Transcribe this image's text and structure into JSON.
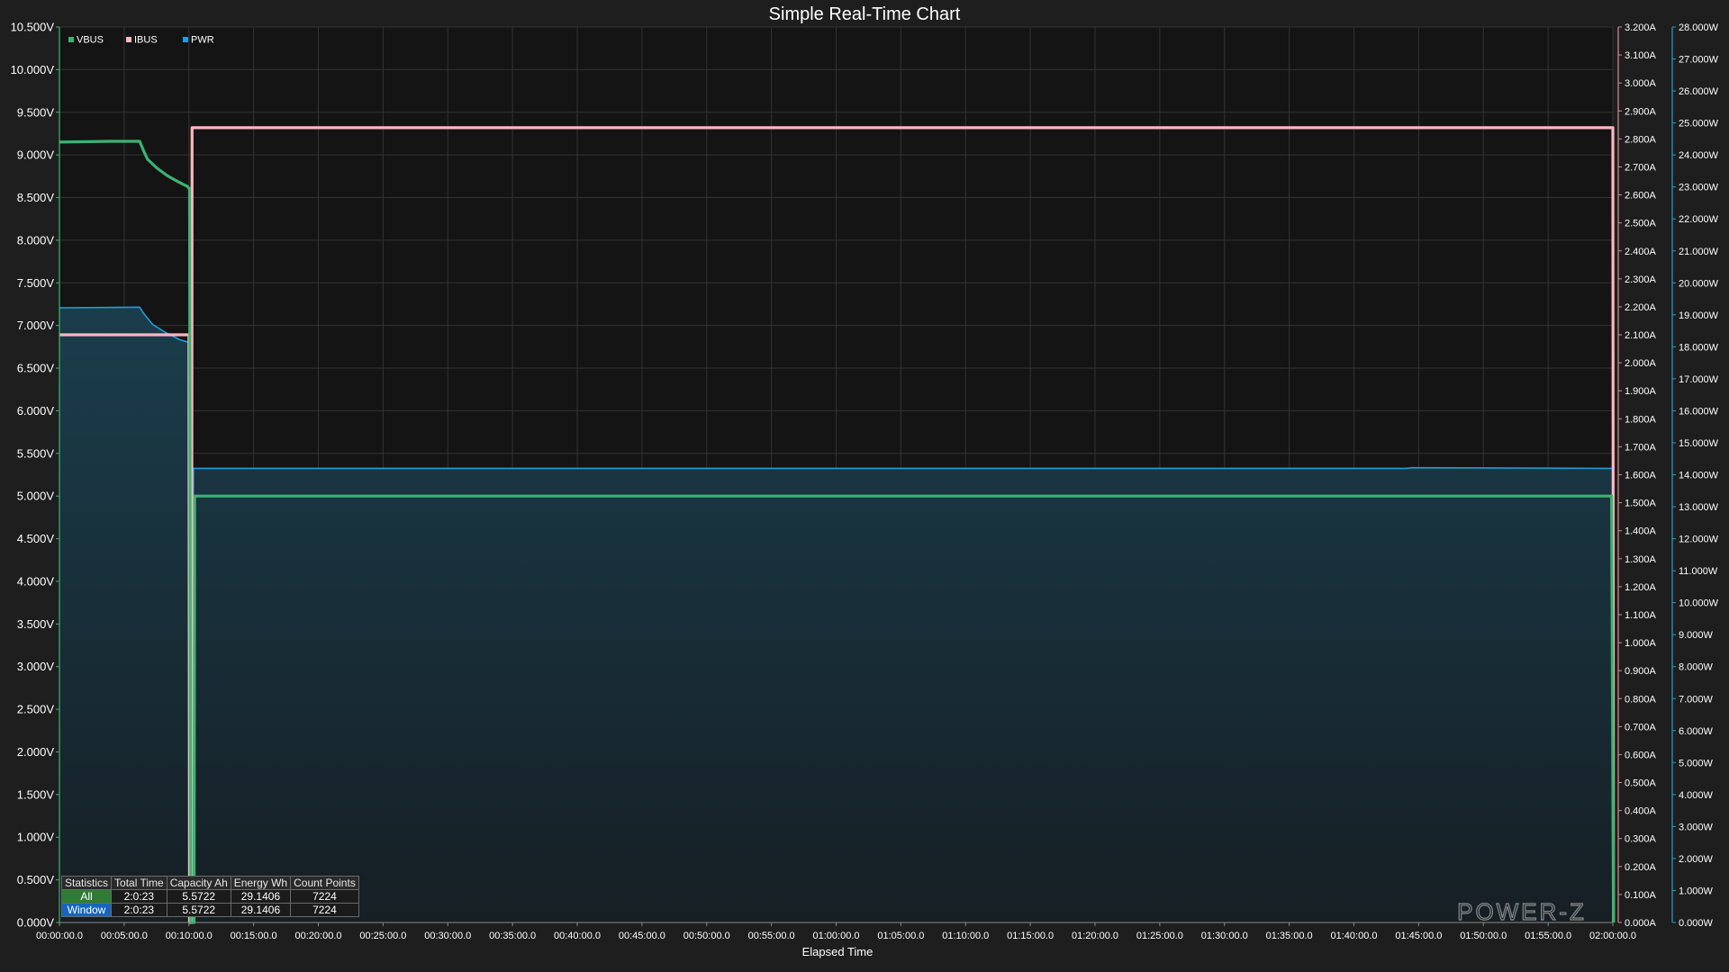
{
  "chart_data": {
    "type": "line",
    "title": "Simple Real-Time Chart",
    "xlabel": "Elapsed Time",
    "x_unit": "minutes",
    "xlim": [
      0,
      120
    ],
    "x_ticks": [
      {
        "value": 0,
        "label": "00:00:00.0"
      },
      {
        "value": 5,
        "label": "00:05:00.0"
      },
      {
        "value": 10,
        "label": "00:10:00.0"
      },
      {
        "value": 15,
        "label": "00:15:00.0"
      },
      {
        "value": 20,
        "label": "00:20:00.0"
      },
      {
        "value": 25,
        "label": "00:25:00.0"
      },
      {
        "value": 30,
        "label": "00:30:00.0"
      },
      {
        "value": 35,
        "label": "00:35:00.0"
      },
      {
        "value": 40,
        "label": "00:40:00.0"
      },
      {
        "value": 45,
        "label": "00:45:00.0"
      },
      {
        "value": 50,
        "label": "00:50:00.0"
      },
      {
        "value": 55,
        "label": "00:55:00.0"
      },
      {
        "value": 60,
        "label": "01:00:00.0"
      },
      {
        "value": 65,
        "label": "01:05:00.0"
      },
      {
        "value": 70,
        "label": "01:10:00.0"
      },
      {
        "value": 75,
        "label": "01:15:00.0"
      },
      {
        "value": 80,
        "label": "01:20:00.0"
      },
      {
        "value": 85,
        "label": "01:25:00.0"
      },
      {
        "value": 90,
        "label": "01:30:00.0"
      },
      {
        "value": 95,
        "label": "01:35:00.0"
      },
      {
        "value": 100,
        "label": "01:40:00.0"
      },
      {
        "value": 105,
        "label": "01:45:00.0"
      },
      {
        "value": 110,
        "label": "01:50:00.0"
      },
      {
        "value": 115,
        "label": "01:55:00.0"
      },
      {
        "value": 120,
        "label": "02:00:00.0"
      }
    ],
    "y_axes": [
      {
        "id": "voltage",
        "side": "left",
        "unit": "V",
        "min": 0,
        "max": 10.5,
        "step": 0.5,
        "decimals": 3,
        "tick_labels": [
          "0.000V",
          "0.500V",
          "1.000V",
          "1.500V",
          "2.000V",
          "2.500V",
          "3.000V",
          "3.500V",
          "4.000V",
          "4.500V",
          "5.000V",
          "5.500V",
          "6.000V",
          "6.500V",
          "7.000V",
          "7.500V",
          "8.000V",
          "8.500V",
          "9.000V",
          "9.500V",
          "10.000V",
          "10.500V"
        ]
      },
      {
        "id": "current",
        "side": "right",
        "unit": "A",
        "min": 0,
        "max": 3.2,
        "step": 0.1,
        "decimals": 3,
        "tick_labels": [
          "0.000A",
          "0.100A",
          "0.200A",
          "0.300A",
          "0.400A",
          "0.500A",
          "0.600A",
          "0.700A",
          "0.800A",
          "0.900A",
          "1.000A",
          "1.100A",
          "1.200A",
          "1.300A",
          "1.400A",
          "1.500A",
          "1.600A",
          "1.700A",
          "1.800A",
          "1.900A",
          "2.000A",
          "2.100A",
          "2.200A",
          "2.300A",
          "2.400A",
          "2.500A",
          "2.600A",
          "2.700A",
          "2.800A",
          "2.900A",
          "3.000A",
          "3.100A",
          "3.200A"
        ]
      },
      {
        "id": "power",
        "side": "right-outer",
        "unit": "W",
        "min": 0,
        "max": 28,
        "step": 1,
        "decimals": 3,
        "tick_labels": [
          "0.000W",
          "1.000W",
          "2.000W",
          "3.000W",
          "4.000W",
          "5.000W",
          "6.000W",
          "7.000W",
          "8.000W",
          "9.000W",
          "10.000W",
          "11.000W",
          "12.000W",
          "13.000W",
          "14.000W",
          "15.000W",
          "16.000W",
          "17.000W",
          "18.000W",
          "19.000W",
          "20.000W",
          "21.000W",
          "22.000W",
          "23.000W",
          "24.000W",
          "25.000W",
          "26.000W",
          "27.000W",
          "28.000W"
        ]
      }
    ],
    "grid": true,
    "legend_position": "top-left",
    "series": [
      {
        "name": "VBUS",
        "axis": "voltage",
        "color": "#3cb371",
        "style": "line",
        "points": [
          [
            0,
            9.15
          ],
          [
            4,
            9.16
          ],
          [
            6.2,
            9.16
          ],
          [
            6.5,
            9.05
          ],
          [
            6.8,
            8.95
          ],
          [
            7.5,
            8.85
          ],
          [
            8.3,
            8.76
          ],
          [
            9,
            8.7
          ],
          [
            9.5,
            8.66
          ],
          [
            9.9,
            8.63
          ],
          [
            10.05,
            8.6
          ],
          [
            10.15,
            0.0
          ],
          [
            10.4,
            0.0
          ],
          [
            10.45,
            5.0
          ],
          [
            60,
            5.0
          ],
          [
            104,
            5.0
          ],
          [
            119.8,
            5.0
          ],
          [
            119.9,
            5.0
          ],
          [
            120.05,
            0.0
          ]
        ]
      },
      {
        "name": "IBUS",
        "axis": "current",
        "color": "#ffb6c1",
        "style": "line",
        "points": [
          [
            0,
            2.1
          ],
          [
            9.9,
            2.1
          ],
          [
            10.0,
            2.1
          ],
          [
            10.05,
            0.0
          ],
          [
            10.2,
            0.0
          ],
          [
            10.25,
            2.84
          ],
          [
            60,
            2.84
          ],
          [
            75,
            2.84
          ],
          [
            119.9,
            2.84
          ],
          [
            120.0,
            2.84
          ],
          [
            120.05,
            0.0
          ]
        ]
      },
      {
        "name": "PWR",
        "axis": "power",
        "color": "#1e9fd8",
        "style": "area",
        "fill": "#17313d",
        "points": [
          [
            0,
            19.22
          ],
          [
            6.2,
            19.24
          ],
          [
            6.5,
            19.05
          ],
          [
            7.2,
            18.7
          ],
          [
            8.2,
            18.45
          ],
          [
            9.3,
            18.22
          ],
          [
            10.0,
            18.14
          ],
          [
            10.05,
            0.0
          ],
          [
            10.3,
            0.0
          ],
          [
            10.35,
            14.2
          ],
          [
            60,
            14.2
          ],
          [
            104,
            14.2
          ],
          [
            104.5,
            14.22
          ],
          [
            119.9,
            14.2
          ],
          [
            120.0,
            14.2
          ],
          [
            120.05,
            0.0
          ]
        ]
      }
    ]
  },
  "statistics": {
    "headers": [
      "Statistics",
      "Total Time",
      "Capacity Ah",
      "Energy Wh",
      "Count Points"
    ],
    "rows": [
      {
        "label": "All",
        "total_time": "2:0:23",
        "capacity": "5.5722",
        "energy": "29.1406",
        "count": "7224"
      },
      {
        "label": "Window",
        "total_time": "2:0:23",
        "capacity": "5.5722",
        "energy": "29.1406",
        "count": "7224"
      }
    ]
  },
  "watermark": "POWER-Z"
}
